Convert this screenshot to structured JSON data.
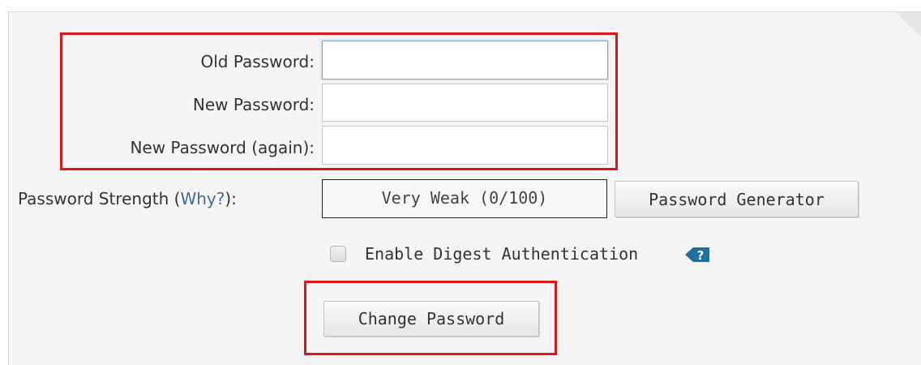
{
  "form": {
    "old_password_label": "Old Password:",
    "new_password_label": "New Password:",
    "new_password_again_label": "New Password (again):",
    "old_password_value": "",
    "new_password_value": "",
    "new_password_again_value": "",
    "strength_label_prefix": "Password Strength (",
    "strength_why_link": "Why?",
    "strength_label_suffix": "):",
    "strength_value": "Very Weak (0/100)",
    "password_generator_button": "Password Generator",
    "digest_auth_label": "Enable Digest Authentication",
    "digest_auth_checked": false,
    "change_password_button": "Change Password"
  },
  "icons": {
    "help": "question-tag-icon"
  },
  "colors": {
    "highlight": "#e0161b",
    "link": "#3f6b9a",
    "help_icon": "#1f6fa0",
    "panel_bg": "#f5f5f5"
  }
}
